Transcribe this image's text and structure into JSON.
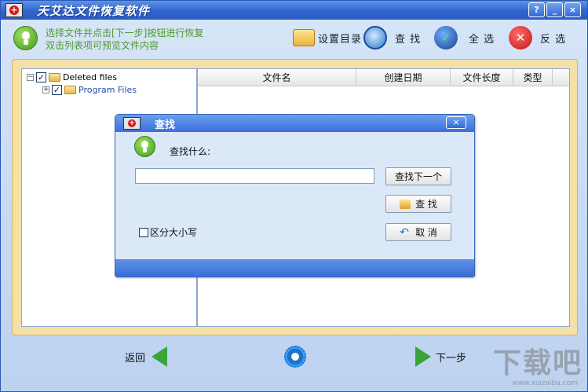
{
  "app": {
    "title": "天艾达文件恢复软件",
    "window_buttons": [
      "?",
      "_",
      "×"
    ]
  },
  "toolbar": {
    "hint_line1": "选择文件并点击[下一步]按钮进行恢复",
    "hint_line2": "双击列表项可预览文件内容",
    "set_dir_label": "设置目录",
    "find_label": "查 找",
    "select_all_label": "全 选",
    "invert_label": "反 选"
  },
  "tree": {
    "items": [
      {
        "label": "Deleted files",
        "expander": "−",
        "checked": "✓"
      },
      {
        "label": "Program Files",
        "expander": "+",
        "checked": "✓"
      }
    ]
  },
  "list": {
    "columns": [
      "文件名",
      "创建日期",
      "文件长度",
      "类型"
    ]
  },
  "nav": {
    "back_label": "返回",
    "next_label": "下一步"
  },
  "watermark": {
    "text": "下载吧",
    "sub": "www.xiazaiba.com"
  },
  "find_dialog": {
    "title": "查找",
    "close": "×",
    "prompt": "查找什么:",
    "input_value": "",
    "find_next_label": "查找下一个",
    "find_label": "查 找",
    "cancel_label": "取 消",
    "case_label": "区分大小写"
  },
  "colors": {
    "titlebar": "#2f64cd",
    "accent_green": "#3aa33a",
    "hint_text": "#4f9a2a",
    "panel_border": "#f4e1a8"
  }
}
